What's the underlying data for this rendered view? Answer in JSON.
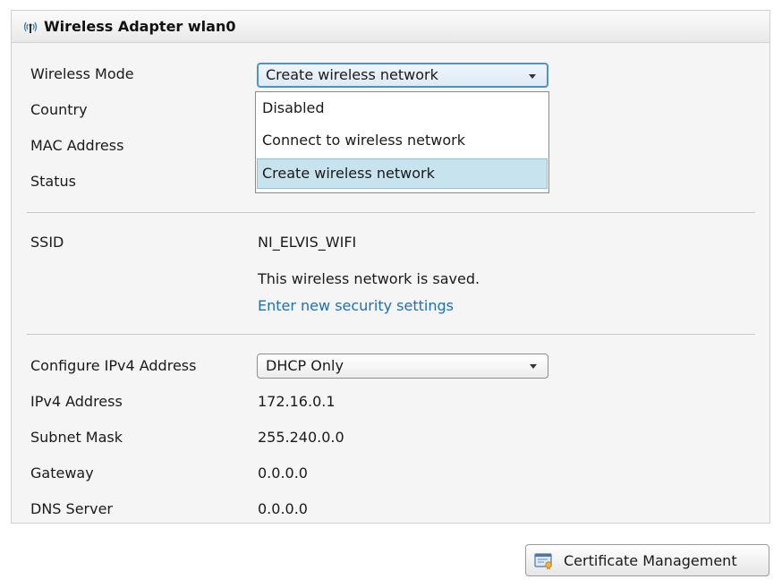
{
  "panel": {
    "title": "Wireless Adapter wlan0",
    "icon": "wireless-signal-icon"
  },
  "labels": {
    "wireless_mode": "Wireless Mode",
    "country": "Country",
    "mac_address": "MAC Address",
    "status": "Status",
    "ssid": "SSID",
    "configure_ipv4": "Configure IPv4 Address",
    "ipv4_address": "IPv4 Address",
    "subnet_mask": "Subnet Mask",
    "gateway": "Gateway",
    "dns_server": "DNS Server"
  },
  "wireless_mode": {
    "selected": "Create wireless network",
    "options": [
      "Disabled",
      "Connect to wireless network",
      "Create wireless network"
    ],
    "expanded": true
  },
  "ssid": {
    "value": "NI_ELVIS_WIFI",
    "saved_note": "This wireless network is saved.",
    "security_link": "Enter new security settings"
  },
  "ipv4": {
    "configure_selected": "DHCP Only",
    "address": "172.16.0.1",
    "subnet_mask": "255.240.0.0",
    "gateway": "0.0.0.0",
    "dns_server": "0.0.0.0"
  },
  "certificate_button": {
    "label": "Certificate Management",
    "icon": "certificate-icon"
  },
  "colors": {
    "link": "#1f6fb3",
    "selected_option": "#c6e3ee",
    "dropdown_focus_border": "#4d93c8"
  }
}
